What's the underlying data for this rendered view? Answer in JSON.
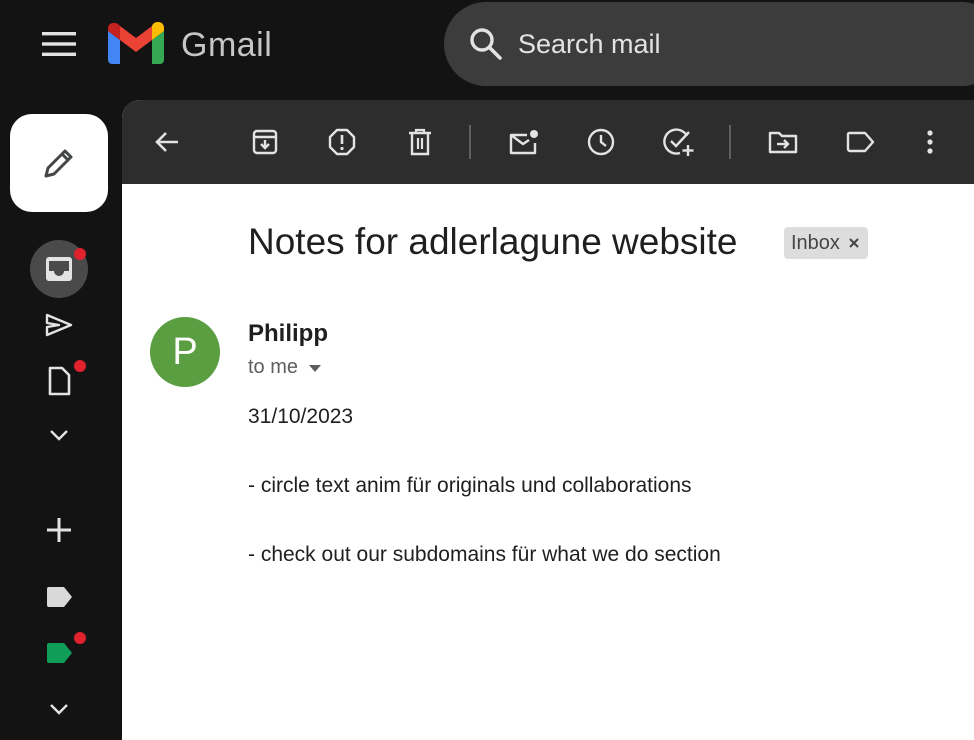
{
  "app": {
    "brand": "Gmail"
  },
  "search": {
    "placeholder": "Search mail"
  },
  "left_rail": {
    "items": [
      {
        "name": "inbox",
        "icon": "inbox-icon",
        "active": true,
        "notification": true
      },
      {
        "name": "sent",
        "icon": "send-icon",
        "active": false,
        "notification": false
      },
      {
        "name": "drafts",
        "icon": "draft-icon",
        "active": false,
        "notification": true
      },
      {
        "name": "more",
        "icon": "chevron-down-icon",
        "active": false,
        "notification": false
      }
    ],
    "create_label_icon": "plus-icon",
    "labels": [
      {
        "icon": "label-icon",
        "color": "#d9d9d9",
        "notification": false
      },
      {
        "icon": "label-icon",
        "color": "#0f9d58",
        "notification": true
      }
    ],
    "labels_more_icon": "chevron-down-icon"
  },
  "toolbar": {
    "icons": [
      "back-arrow-icon",
      "archive-icon",
      "report-spam-icon",
      "delete-icon",
      "mark-unread-icon",
      "snooze-icon",
      "add-to-tasks-icon",
      "move-to-icon",
      "label-icon",
      "more-vert-icon"
    ]
  },
  "email": {
    "subject": "Notes for adlerlagune website",
    "label": "Inbox",
    "sender": "Philipp",
    "avatar_letter": "P",
    "avatar_color": "#5a9e41",
    "recipient": "to me",
    "body": [
      "31/10/2023",
      "- circle text anim für originals und collaborations",
      "- check out our subdomains für what we do section"
    ]
  },
  "colors": {
    "background": "#131313",
    "toolbar": "#2d2d2d",
    "search": "#3c3c3c",
    "notification_dot": "#e1222c"
  }
}
